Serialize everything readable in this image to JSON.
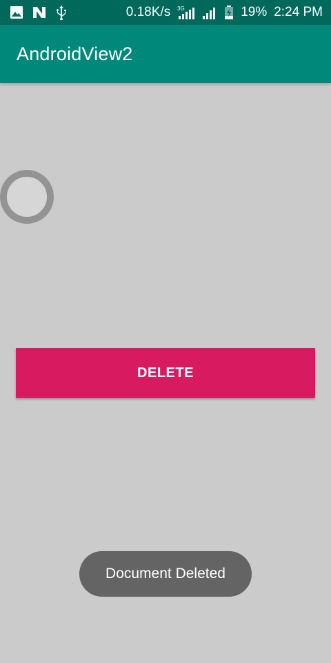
{
  "status_bar": {
    "icons_left": [
      "image-icon",
      "n-notification-icon",
      "usb-icon"
    ],
    "net_speed": "0.18K/s",
    "network_label": "3G",
    "battery_percent": "19%",
    "time": "2:24 PM"
  },
  "app_bar": {
    "title": "AndroidView2",
    "color": "#00897b"
  },
  "main": {
    "radio_checked": false,
    "delete_button_label": "DELETE",
    "delete_button_color": "#d81b60"
  },
  "toast": {
    "message": "Document Deleted"
  }
}
